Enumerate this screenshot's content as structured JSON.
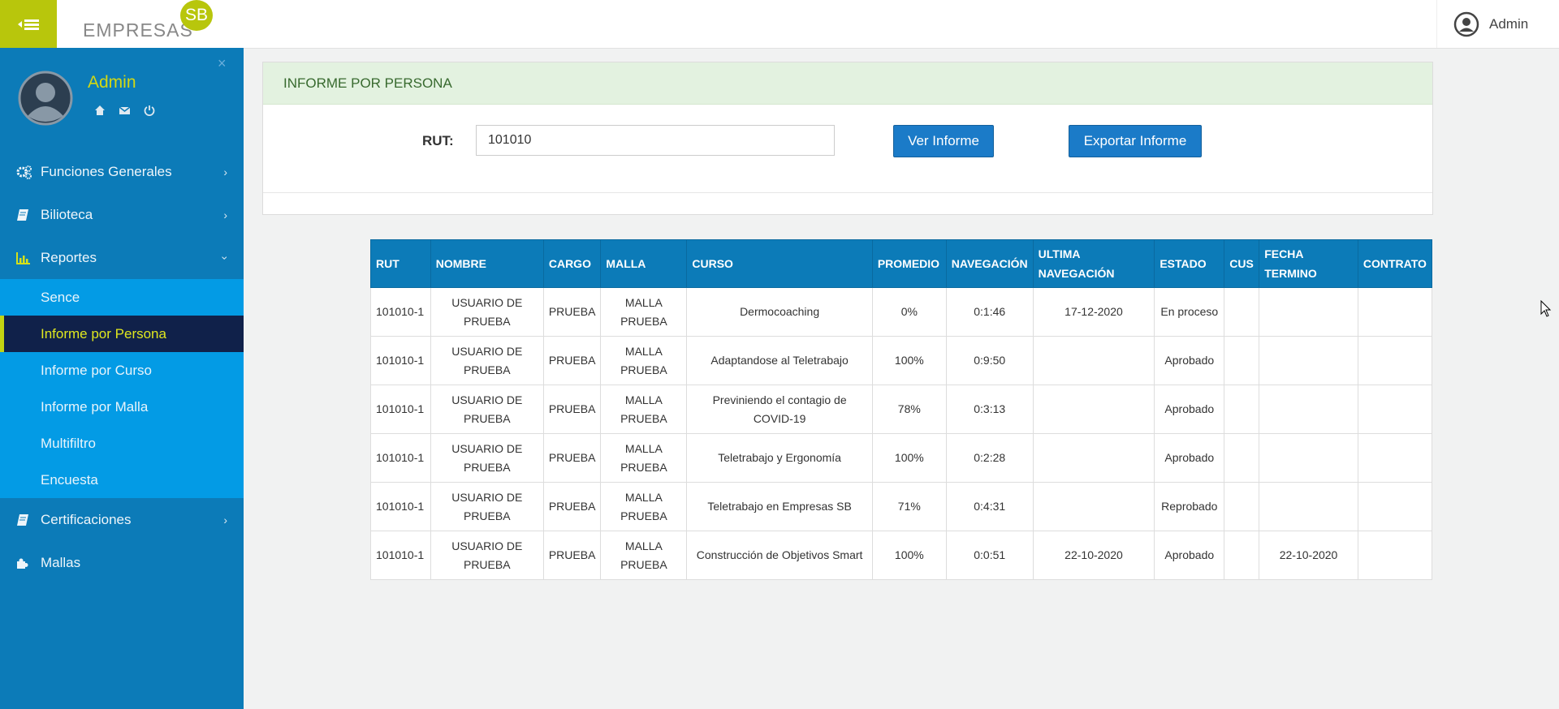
{
  "topbar": {
    "logo_text": "EMPRESAS",
    "logo_badge": "SB",
    "user_name": "Admin"
  },
  "sidebar": {
    "profile_name": "Admin",
    "menu": [
      {
        "label": "Funciones Generales",
        "icon": "gears-icon"
      },
      {
        "label": "Bilioteca",
        "icon": "book-icon"
      },
      {
        "label": "Reportes",
        "icon": "bar-chart-icon"
      },
      {
        "label": "Certificaciones",
        "icon": "book-icon"
      },
      {
        "label": "Mallas",
        "icon": "puzzle-icon"
      }
    ],
    "submenu": [
      "Sence",
      "Informe por Persona",
      "Informe por Curso",
      "Informe por Malla",
      "Multifiltro",
      "Encuesta"
    ],
    "active_submenu": "Informe por Persona"
  },
  "panel": {
    "title": "INFORME POR PERSONA",
    "rut_label": "RUT:",
    "rut_value": "101010",
    "ver_button": "Ver Informe",
    "export_button": "Exportar Informe"
  },
  "table": {
    "headers": [
      "RUT",
      "NOMBRE",
      "CARGO",
      "MALLA",
      "CURSO",
      "PROMEDIO",
      "NAVEGACIÓN",
      "ULTIMA NAVEGACIÓN",
      "ESTADO",
      "CUS",
      "FECHA TERMINO",
      "CONTRATO"
    ],
    "rows": [
      [
        "101010-1",
        "USUARIO DE PRUEBA",
        "PRUEBA",
        "MALLA PRUEBA",
        "Dermocoaching",
        "0%",
        "0:1:46",
        "17-12-2020",
        "En proceso",
        "",
        "",
        ""
      ],
      [
        "101010-1",
        "USUARIO DE PRUEBA",
        "PRUEBA",
        "MALLA PRUEBA",
        "Adaptandose al Teletrabajo",
        "100%",
        "0:9:50",
        "",
        "Aprobado",
        "",
        "",
        ""
      ],
      [
        "101010-1",
        "USUARIO DE PRUEBA",
        "PRUEBA",
        "MALLA PRUEBA",
        "Previniendo el contagio de COVID-19",
        "78%",
        "0:3:13",
        "",
        "Aprobado",
        "",
        "",
        ""
      ],
      [
        "101010-1",
        "USUARIO DE PRUEBA",
        "PRUEBA",
        "MALLA PRUEBA",
        "Teletrabajo y Ergonomía",
        "100%",
        "0:2:28",
        "",
        "Aprobado",
        "",
        "",
        ""
      ],
      [
        "101010-1",
        "USUARIO DE PRUEBA",
        "PRUEBA",
        "MALLA PRUEBA",
        "Teletrabajo en Empresas SB",
        "71%",
        "0:4:31",
        "",
        "Reprobado",
        "",
        "",
        ""
      ],
      [
        "101010-1",
        "USUARIO DE PRUEBA",
        "PRUEBA",
        "MALLA PRUEBA",
        "Construcción de Objetivos Smart",
        "100%",
        "0:0:51",
        "22-10-2020",
        "Aprobado",
        "",
        "22-10-2020",
        ""
      ]
    ]
  }
}
